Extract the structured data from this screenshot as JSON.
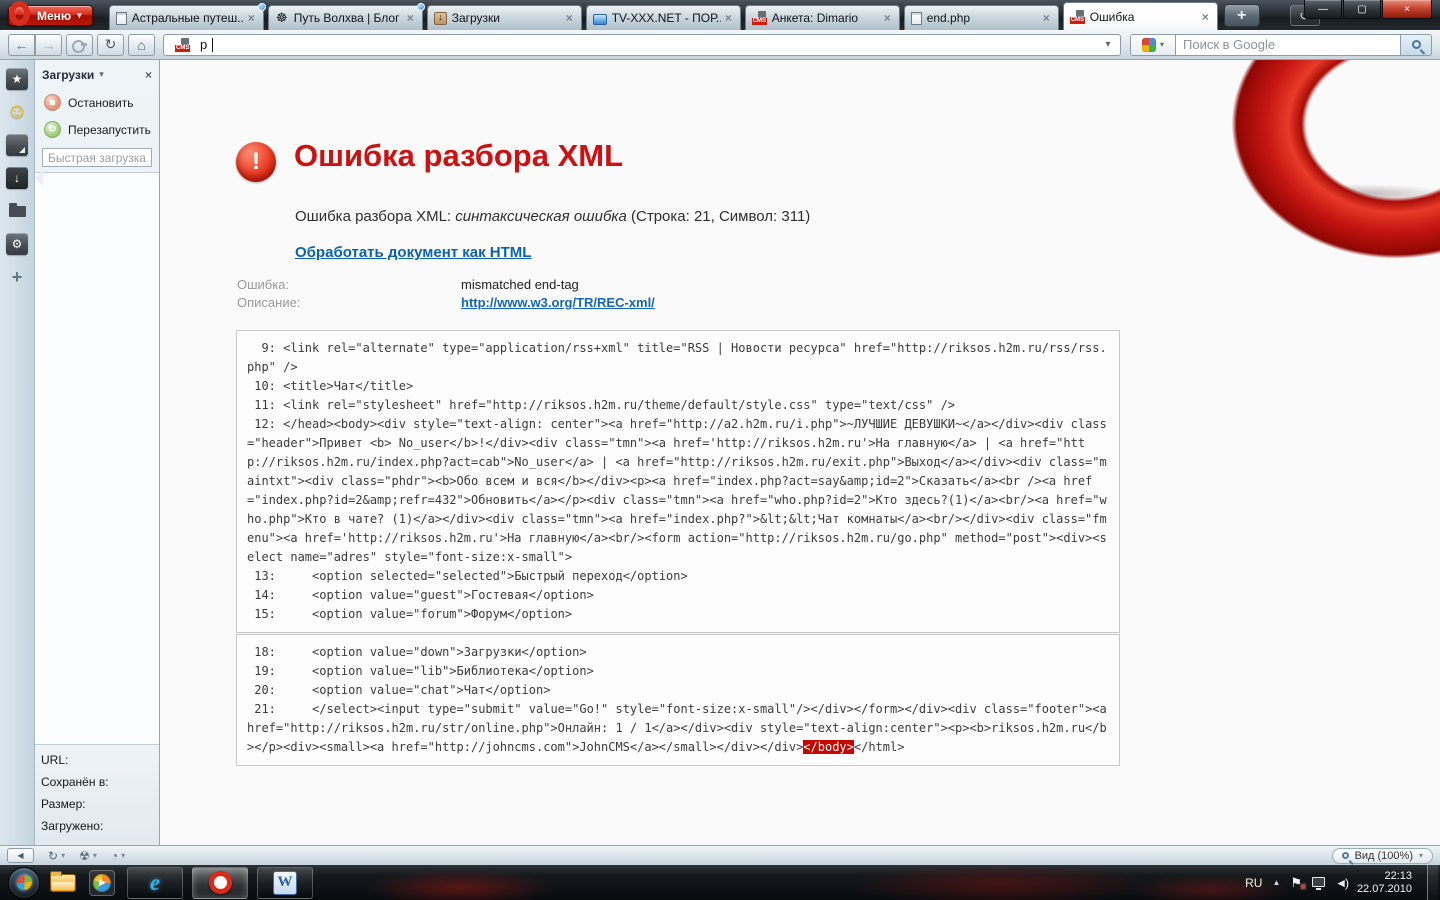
{
  "window": {
    "menu_label": "Меню"
  },
  "tabs": [
    {
      "label": "Астральные путеш...",
      "icon": "page-icon",
      "dot": true,
      "active": false
    },
    {
      "label": "Путь Волхва | Блог ...",
      "icon": "triskelion-icon",
      "dot": true,
      "active": false
    },
    {
      "label": "Загрузки",
      "icon": "download-icon",
      "dot": false,
      "active": false
    },
    {
      "label": "TV-XXX.NET - ПОР...",
      "icon": "tv-icon",
      "dot": false,
      "active": false
    },
    {
      "label": "Анкета: Dimario",
      "icon": "cms-icon",
      "dot": false,
      "active": false
    },
    {
      "label": "end.php",
      "icon": "page-icon",
      "dot": false,
      "active": false
    },
    {
      "label": "Ошибка",
      "icon": "cms-icon",
      "dot": false,
      "active": true
    }
  ],
  "icon_glyphs": {
    "page-icon": "",
    "triskelion-icon": "☸",
    "download-icon": "↓",
    "tv-icon": "",
    "cms-icon": "CMS"
  },
  "icons": {
    "close_x": "×",
    "caret": "▾",
    "back": "←",
    "forward": "→",
    "reload": "↻",
    "home": "⌂",
    "plus": "+",
    "trash": "↺",
    "minimize": "—",
    "maximize": "▢",
    "panel_toggle": "◀",
    "up_tray": "▲",
    "flag": "⚑",
    "speaker": "◄)",
    "play": "▶",
    "exclaim": "!"
  },
  "toolbar": {
    "address_value": "p",
    "search_placeholder": "Поиск в Google"
  },
  "sidebar": {
    "icons": [
      {
        "name": "bookmarks-panel-icon",
        "glyph": "★",
        "style": "dark"
      },
      {
        "name": "smiley-panel-icon",
        "glyph": "☺",
        "style": "smiley"
      },
      {
        "name": "notes-panel-icon",
        "glyph": "",
        "style": "dark notes"
      },
      {
        "name": "downloads-panel-icon",
        "glyph": "↓",
        "style": "dark active"
      },
      {
        "name": "folder-panel-icon",
        "glyph": "",
        "style": "folderic"
      },
      {
        "name": "widgets-panel-icon",
        "glyph": "⚙",
        "style": "dark"
      },
      {
        "name": "add-panel-icon",
        "glyph": "+",
        "style": "plus"
      }
    ]
  },
  "panel": {
    "title": "Загрузки",
    "stop_label": "Остановить",
    "restart_label": "Перезапустить",
    "quick_download_placeholder": "Быстрая загрузка",
    "info_labels": [
      "URL:",
      "Сохранён в:",
      "Размер:",
      "Загружено:"
    ]
  },
  "page": {
    "title": "Ошибка разбора XML",
    "subtitle_prefix": "Ошибка разбора XML: ",
    "subtitle_em": "синтаксическая ошибка",
    "subtitle_suffix": " (Строка: 21, Символ: 311)",
    "action_link": "Обработать документ как HTML",
    "error_label": "Ошибка:",
    "error_value": "mismatched end-tag",
    "description_label": "Описание:",
    "description_link": "http://www.w3.org/TR/REC-xml/",
    "colors": {
      "error_red": "#cf1010",
      "link_blue": "#1467b8",
      "highlight_bg": "#c70700"
    },
    "codeblocks": [
      {
        "lines": [
          [
            {
              "t": "  9: <link rel=\"alternate\" type=\"application/rss+xml\" title=\"RSS | Новости ресурса\" href=\"http://riksos.h2m.ru/rss/rss.php\" />",
              "hl": false
            }
          ],
          [
            {
              "t": " 10: <title>Чат</title>",
              "hl": false
            }
          ],
          [
            {
              "t": " 11: <link rel=\"stylesheet\" href=\"http://riksos.h2m.ru/theme/default/style.css\" type=\"text/css\" />",
              "hl": false
            }
          ],
          [
            {
              "t": " 12: </head><body><div style=\"text-align: center\"><a href=\"http://a2.h2m.ru/i.php\">~ЛУЧШИЕ ДЕВУШКИ~</a></div><div class=\"header\">Привет <b> No_user</b>!</div><div class=\"tmn\"><a href='http://riksos.h2m.ru'>На главную</a> | <a href=\"http://riksos.h2m.ru/index.php?act=cab\">No_user</a> | <a href=\"http://riksos.h2m.ru/exit.php\">Выход</a></div><div class=\"maintxt\"><div class=\"phdr\"><b>Обо всем и вся</b></div><p><a href=\"index.php?act=say&amp;id=2\">Сказать</a><br /><a href=\"index.php?id=2&amp;refr=432\">Обновить</a></p><div class=\"tmn\"><a href=\"who.php?id=2\">Кто здесь?(1)</a><br/><a href=\"who.php\">Кто в чате? (1)</a></div><div class=\"tmn\"><a href=\"index.php?\">&lt;&lt;Чат комнаты</a><br/></div><div class=\"fmenu\"><a href='http://riksos.h2m.ru'>На главную</a><br/><form action=\"http://riksos.h2m.ru/go.php\" method=\"post\"><div><select name=\"adres\" style=\"font-size:x-small\">",
              "hl": false
            }
          ],
          [
            {
              "t": " 13:     <option selected=\"selected\">Быстрый переход</option>",
              "hl": false
            }
          ],
          [
            {
              "t": " 14:     <option value=\"guest\">Гостевая</option>",
              "hl": false
            }
          ],
          [
            {
              "t": " 15:     <option value=\"forum\">Форум</option>",
              "hl": false
            }
          ]
        ]
      },
      {
        "lines": [
          [
            {
              "t": " 18:     <option value=\"down\">Загрузки</option>",
              "hl": false
            }
          ],
          [
            {
              "t": " 19:     <option value=\"lib\">Библиотека</option>",
              "hl": false
            }
          ],
          [
            {
              "t": " 20:     <option value=\"chat\">Чат</option>",
              "hl": false
            }
          ],
          [
            {
              "t": " 21:     </select><input type=\"submit\" value=\"Go!\" style=\"font-size:x-small\"/></div></form></div><div class=\"footer\"><a href=\"http://riksos.h2m.ru/str/online.php\">Онлайн: 1 / 1</a></div><div style=\"text-align:center\"><p><b>riksos.h2m.ru</b></p><div><small><a href=\"http://johncms.com\">JohnCMS</a></small></div></div>",
              "hl": false
            },
            {
              "t": "</body>",
              "hl": true
            },
            {
              "t": "</html>",
              "hl": false
            }
          ]
        ]
      }
    ]
  },
  "statusbar": {
    "zoom_label": "Вид (100%)",
    "quick_icons": [
      {
        "name": "sync-icon",
        "glyph": "↻"
      },
      {
        "name": "turbo-icon",
        "glyph": "☢"
      },
      {
        "name": "bandwidth-icon",
        "glyph": "◔"
      }
    ]
  },
  "taskbar": {
    "language": "RU",
    "time": "22:13",
    "date": "22.07.2010"
  }
}
